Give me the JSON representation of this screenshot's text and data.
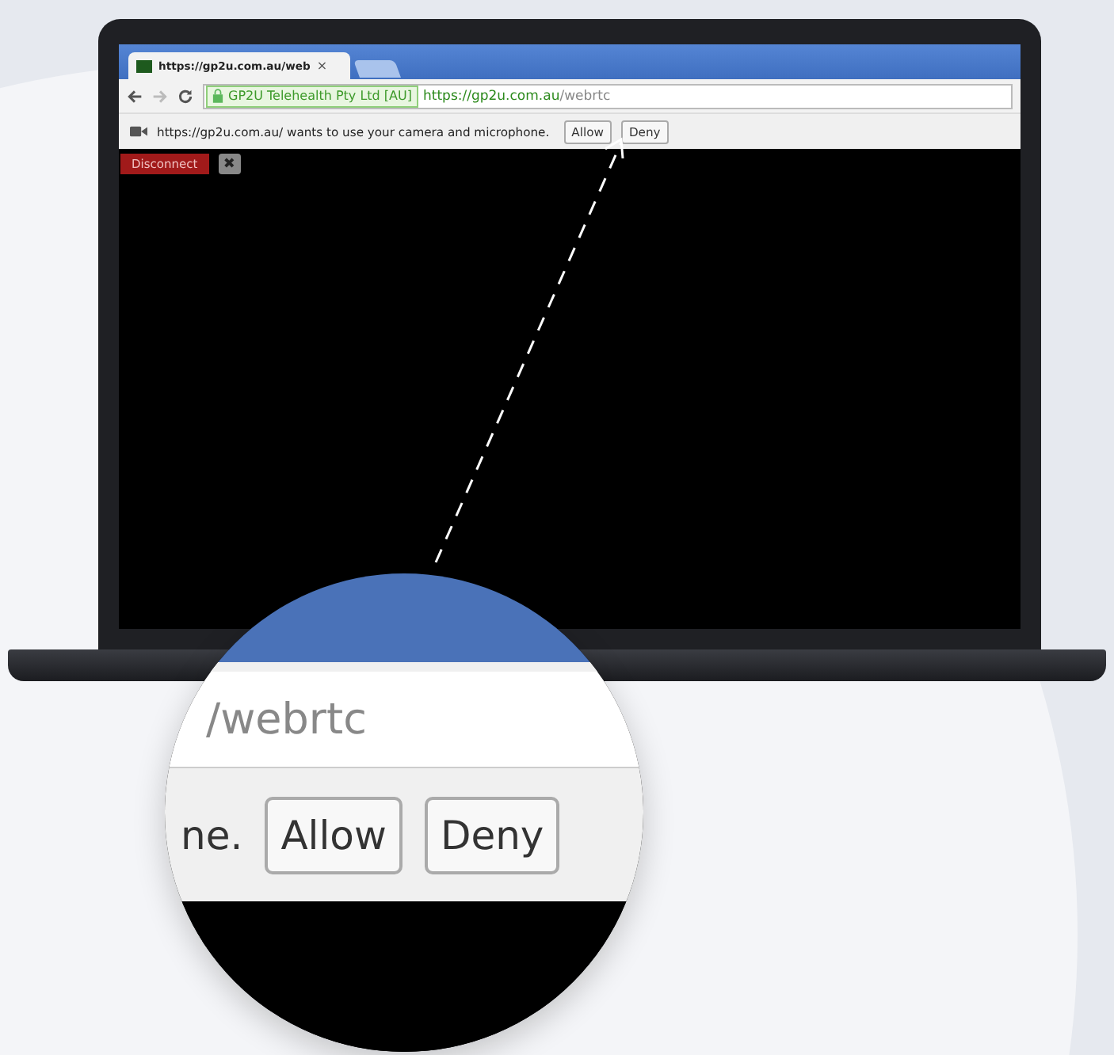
{
  "browser": {
    "tab": {
      "title": "https://gp2u.com.au/web",
      "close": "×"
    },
    "address_bar": {
      "identity": "GP2U Telehealth Pty Ltd [AU]",
      "url_host": "https://gp2u.com.au",
      "url_path": "/webrtc"
    },
    "infobar": {
      "message": "https://gp2u.com.au/ wants to use your camera and microphone.",
      "buttons": [
        "Allow",
        "Deny"
      ]
    },
    "page": {
      "disconnect": "Disconnect",
      "close": "✖"
    }
  },
  "magnifier": {
    "url_fragment": "/webrtc",
    "message_fragment": "ne.",
    "buttons": [
      "Allow",
      "Deny"
    ]
  }
}
